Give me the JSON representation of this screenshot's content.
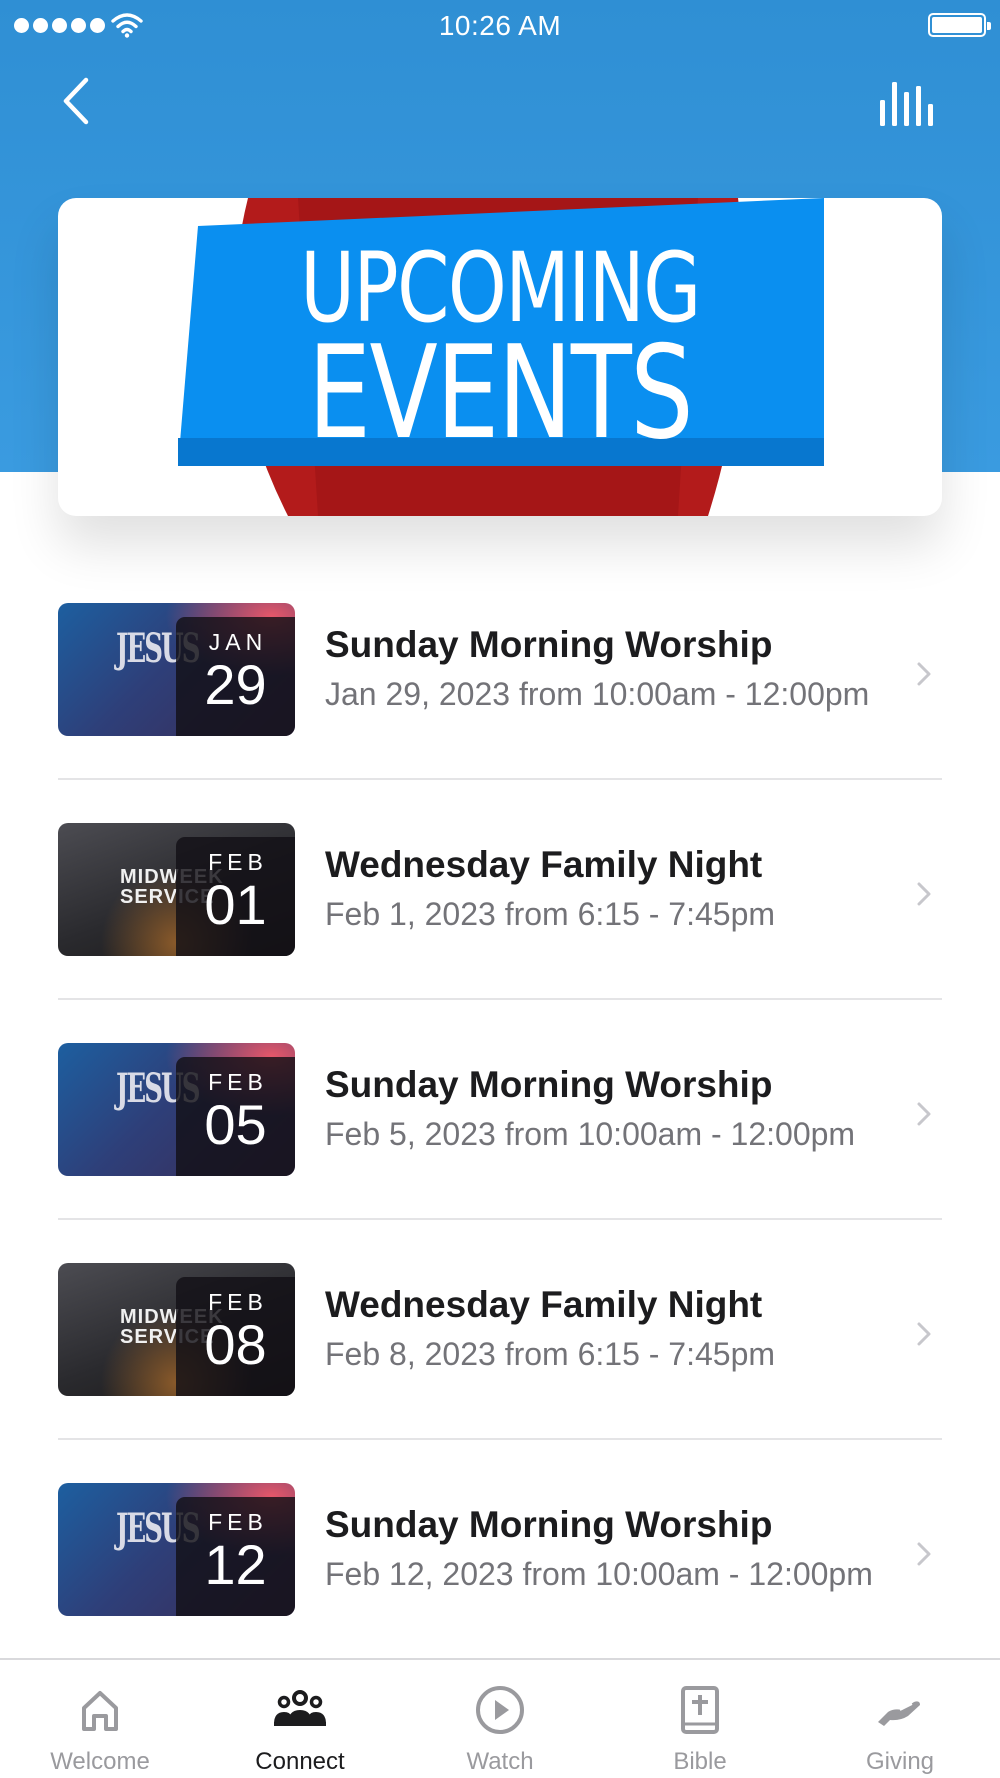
{
  "status_bar": {
    "time": "10:26 AM"
  },
  "header": {
    "back_icon": "chevron-left-icon",
    "stats_icon": "bar-chart-icon"
  },
  "banner": {
    "line1": "UPCOMING",
    "line2": "EVENTS",
    "colors": {
      "panel": "#0a8ff0",
      "curtain": "#b31b1b"
    }
  },
  "events": [
    {
      "thumb": "jesus",
      "thumb_text": "JESUS",
      "month": "JAN",
      "day": "29",
      "title": "Sunday Morning Worship",
      "subtitle": "Jan 29, 2023 from 10:00am - 12:00pm"
    },
    {
      "thumb": "midweek",
      "thumb_text": "MIDWEEK\nSERVICE",
      "month": "FEB",
      "day": "01",
      "title": "Wednesday Family Night",
      "subtitle": "Feb 1, 2023 from 6:15 - 7:45pm"
    },
    {
      "thumb": "jesus",
      "thumb_text": "JESUS",
      "month": "FEB",
      "day": "05",
      "title": "Sunday Morning Worship",
      "subtitle": "Feb 5, 2023 from 10:00am - 12:00pm"
    },
    {
      "thumb": "midweek",
      "thumb_text": "MIDWEEK\nSERVICE",
      "month": "FEB",
      "day": "08",
      "title": "Wednesday Family Night",
      "subtitle": "Feb 8, 2023 from 6:15 - 7:45pm"
    },
    {
      "thumb": "jesus",
      "thumb_text": "JESUS",
      "month": "FEB",
      "day": "12",
      "title": "Sunday Morning Worship",
      "subtitle": "Feb 12, 2023 from 10:00am - 12:00pm"
    }
  ],
  "tabs": [
    {
      "label": "Welcome",
      "icon": "home-icon",
      "active": false
    },
    {
      "label": "Connect",
      "icon": "people-icon",
      "active": true
    },
    {
      "label": "Watch",
      "icon": "play-circle-icon",
      "active": false
    },
    {
      "label": "Bible",
      "icon": "bible-icon",
      "active": false
    },
    {
      "label": "Giving",
      "icon": "giving-hand-icon",
      "active": false
    }
  ],
  "colors": {
    "header_blue": "#3a9be0",
    "active_tab": "#1c1c1e",
    "inactive_tab": "#9a9a9e",
    "subtitle_gray": "#737378"
  }
}
